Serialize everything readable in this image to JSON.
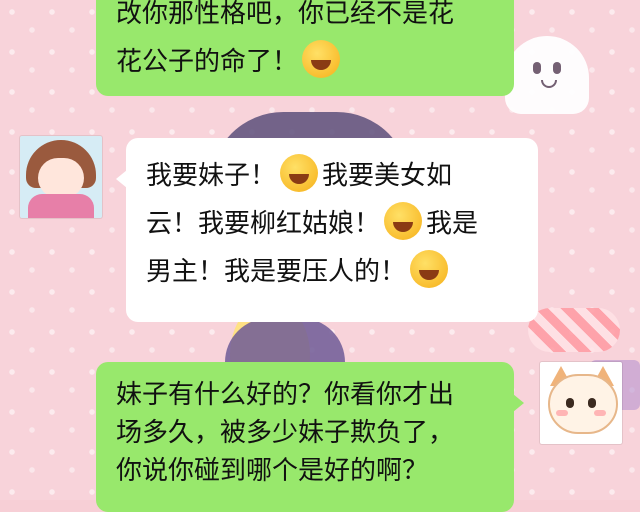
{
  "chat": {
    "messages": [
      {
        "side": "right",
        "lines": [
          "改你那性格吧，你已经不是花",
          "花公子的命了！"
        ]
      },
      {
        "side": "left",
        "lines": [
          "我要妹子！",
          "我要美女如",
          "云！我要柳红姑娘！",
          "我是",
          "男主！我是要压人的！"
        ]
      },
      {
        "side": "right",
        "lines": [
          "妹子有什么好的？你看你才出",
          "场多久，被多少妹子欺负了，",
          "你说你碰到哪个是好的啊？"
        ]
      }
    ]
  },
  "emojis": [
    "grin-squint-emoji",
    "grin-squint-emoji",
    "blush-emoji",
    "grin-squint-emoji"
  ],
  "colors": {
    "green_bubble": "#98e86c",
    "white_bubble": "#ffffff",
    "background": "#f8d3da"
  }
}
